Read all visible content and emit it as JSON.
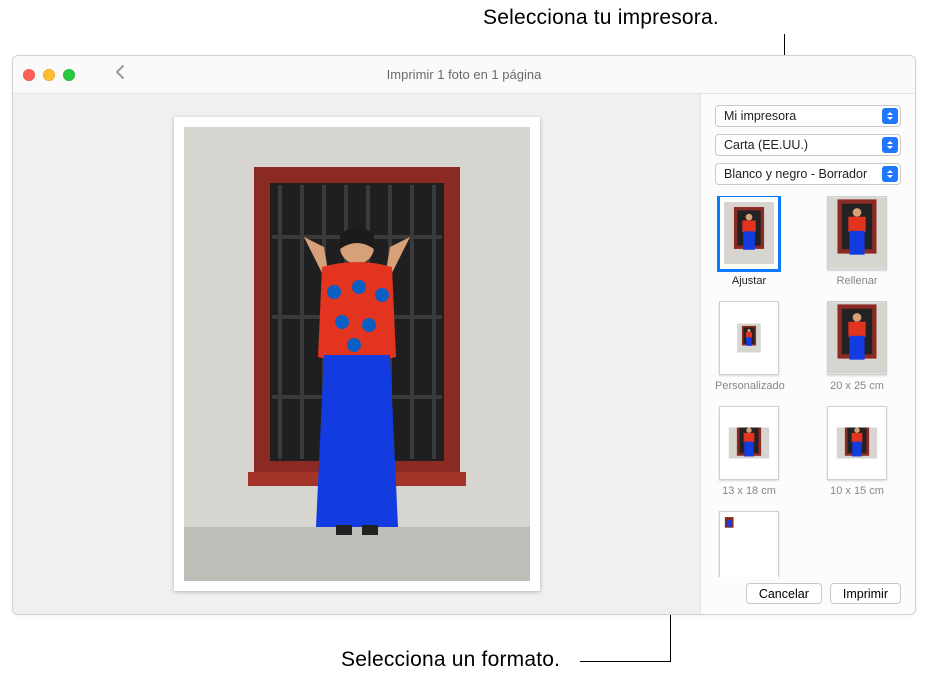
{
  "callouts": {
    "printer": "Selecciona tu impresora.",
    "format": "Selecciona un formato."
  },
  "window_title": "Imprimir 1 foto en 1 página",
  "selects": {
    "printer": "Mi impresora",
    "paper": "Carta (EE.UU.)",
    "quality": "Blanco y negro - Borrador"
  },
  "formats": [
    {
      "id": "ajustar",
      "label": "Ajustar",
      "selected": true,
      "mode": "fit"
    },
    {
      "id": "rellenar",
      "label": "Rellenar",
      "selected": false,
      "mode": "fill"
    },
    {
      "id": "personalizado",
      "label": "Personalizado",
      "selected": false,
      "mode": "custom"
    },
    {
      "id": "20x25",
      "label": "20 x 25 cm",
      "selected": false,
      "mode": "fill"
    },
    {
      "id": "13x18",
      "label": "13 x 18 cm",
      "selected": false,
      "mode": "center"
    },
    {
      "id": "10x15",
      "label": "10 x 15 cm",
      "selected": false,
      "mode": "center"
    },
    {
      "id": "contact",
      "label": "",
      "selected": false,
      "mode": "contact"
    }
  ],
  "buttons": {
    "cancel": "Cancelar",
    "print": "Imprimir"
  }
}
